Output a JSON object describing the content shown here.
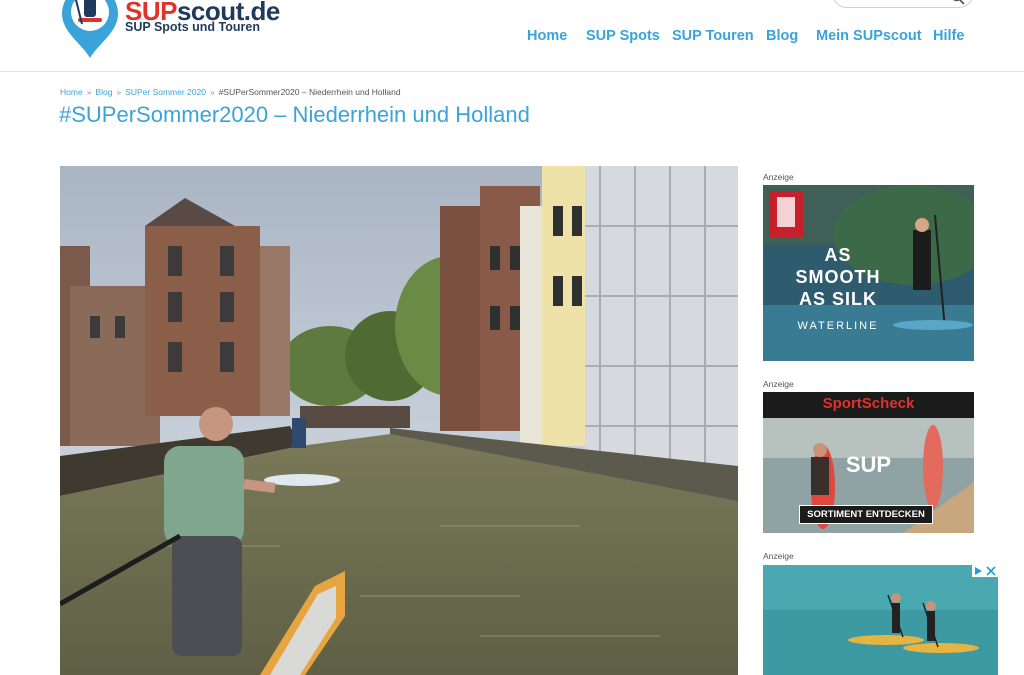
{
  "header": {
    "logo": {
      "brand_a": "SUP",
      "brand_b": "scout.de",
      "subtitle": "SUP Spots und Touren"
    },
    "nav": [
      {
        "label": "Home"
      },
      {
        "label": "SUP Spots"
      },
      {
        "label": "SUP Touren"
      },
      {
        "label": "Blog"
      },
      {
        "label": "Mein SUPscout"
      },
      {
        "label": "Hilfe"
      }
    ],
    "search": {
      "icon": "search-icon"
    }
  },
  "breadcrumb": {
    "items": [
      {
        "label": "Home"
      },
      {
        "label": "Blog"
      },
      {
        "label": "SUPer Sommer 2020"
      },
      {
        "label": "#SUPerSommer2020 – Niederrhein und Holland"
      }
    ],
    "separator": "»"
  },
  "page": {
    "title": "#SUPerSommer2020 – Niederrhein und Holland"
  },
  "sidebar": {
    "ads": [
      {
        "label": "Anzeige",
        "line1": "AS",
        "line2": "SMOOTH",
        "line3": "AS SILK",
        "tagline": "WATERLINE"
      },
      {
        "label": "Anzeige",
        "brand": "SportScheck",
        "headline": "SUP",
        "button": "SORTIMENT ENTDECKEN"
      },
      {
        "label": "Anzeige"
      }
    ]
  },
  "colors": {
    "accent": "#3aa3d9",
    "brand_red": "#e0312b",
    "brand_navy": "#1f3a5a"
  }
}
